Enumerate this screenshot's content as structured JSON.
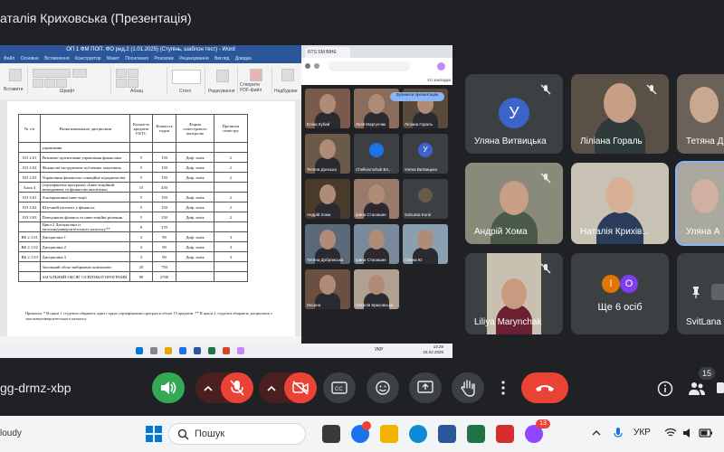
{
  "window": {
    "title": "аталія Криховська (Презентація)"
  },
  "word": {
    "title_bar": "ОП 1 ФМ ПОП. ФО ред.2 (1.01.2025) (Ступінь, шаблон тест) - Word",
    "tabs": [
      "Файл",
      "Основне",
      "Вставлення",
      "Конструктор",
      "Макет",
      "Посилання",
      "Розсилки",
      "Рецензування",
      "Вигляд",
      "Довідка"
    ],
    "ribbon_labels": [
      "Вставити",
      "Шрифт",
      "Абзац",
      "Стилі",
      "Редагування",
      "Створити PDF-файл",
      "Надбудови"
    ],
    "table_headers": [
      "№ з/п",
      "Назва навчальної дисципліни",
      "Кількість кредитів ЄКТС",
      "Кількість годин",
      "Форма семестрового контролю",
      "Протягом семестру"
    ],
    "table_rows": [
      [
        "",
        "управління",
        "",
        "",
        "",
        ""
      ],
      [
        "ЕО 2.01",
        "Ризиково-орієнтоване управління фінансами",
        "5",
        "150",
        "Диф. залік",
        "2"
      ],
      [
        "ЕО 2.02",
        "Фінансові інструменти публічних закупівель",
        "5",
        "150",
        "Диф. залік",
        "2"
      ],
      [
        "ЕО 2.03",
        "Управління фінансово-санаційне підприємства",
        "5",
        "150",
        "Диф. залік",
        "2"
      ],
      [
        "Блок 3",
        "(сертифікатна програма) «Інвестиційний менеджмент та фінансова аналітика»",
        "15",
        "450",
        "",
        ""
      ],
      [
        "ЕО 3.01",
        "Альтернативні інвестиції",
        "5",
        "150",
        "Диф. залік",
        "2"
      ],
      [
        "ЕО 3.02",
        "Штучний інтелект у фінансах",
        "5",
        "150",
        "Диф. залік",
        "2"
      ],
      [
        "ЕО 3.03",
        "Поведінкові фінанси та інвестиційні рішення",
        "5",
        "150",
        "Диф. залік",
        "2"
      ],
      [
        "",
        "Цикл 2 Дисципліни із загальноуніверситетського каталогу**",
        "9",
        "270",
        "",
        ""
      ],
      [
        "ВБ 2.1.01",
        "Дисципліна 1",
        "3",
        "90",
        "Диф. залік",
        "3"
      ],
      [
        "ВБ 2.1.02",
        "Дисципліна 2",
        "3",
        "90",
        "Диф. залік",
        "3"
      ],
      [
        "ВБ 2.1.03",
        "Дисципліна 3",
        "3",
        "90",
        "Диф. залік",
        "3"
      ],
      [
        "",
        "Загальний обсяг вибіркових компонент",
        "25",
        "750",
        "",
        ""
      ],
      [
        "",
        "ЗАГАЛЬНИЙ ОБСЯГ ОСВІТНЬОЇ ПРОГРАМИ",
        "90",
        "2700",
        "",
        ""
      ]
    ],
    "notes": "Примітка: * В циклі 1 студенти обирають один з трьох сертифікатних програм в обсязі 15 кредитів. ** В циклі 2 студенти обирають дисципліни з загальноуніверситетського каталогу."
  },
  "chrome": {
    "tab_title": "RTS SM ВІНЕ рейти...",
    "bookmarks": "Усі закладки",
    "share_pill": "Зупинити презентацію",
    "tiles": [
      {
        "name": "Еліна Кубай",
        "color": "#7a5a4a"
      },
      {
        "name": "Лілія Маргунчак",
        "color": "#8b6b5a"
      },
      {
        "name": "Ліліана Гораль",
        "color": "#5a4a3a"
      },
      {
        "name": "Тетяна Донська",
        "color": "#6b5a4a"
      },
      {
        "name": "Chelkovnichuk Вл...",
        "avatar": "#1a73e8"
      },
      {
        "name": "Уляна Витвицька",
        "avatar": "#3c63c9",
        "initial": "У"
      },
      {
        "name": "Андрій Хома",
        "color": "#4a3a2a"
      },
      {
        "name": "Ірина Стасишин",
        "color": "#9a7a6a"
      },
      {
        "name": "SvitLana Kurul",
        "avatar": "#6a5a4a"
      },
      {
        "name": "Тетяна Добрянська",
        "color": "#5a6a7a"
      },
      {
        "name": "Ірина Стасишин",
        "color": "#7a8a9a"
      },
      {
        "name": "Олена Ю",
        "color": "#8aa0b0"
      },
      {
        "name": "Оксана",
        "color": "#6a5040"
      },
      {
        "name": "Наталія Криховська",
        "color": "#b0a090"
      }
    ],
    "time": "14:29",
    "date": "18.02.2025",
    "lang": "УКР"
  },
  "participants": [
    {
      "name": "Уляна Витвицька",
      "initial": "У"
    },
    {
      "name": "Ліліана Гораль"
    },
    {
      "name": "Тетяна Д"
    },
    {
      "name": "Андрій Хома"
    },
    {
      "name": "Наталія Крихів..."
    },
    {
      "name": "Уляна А"
    },
    {
      "name": "Liliya Marynchak"
    },
    {
      "name": "Ще 6 осіб",
      "initials": [
        "І",
        "О"
      ]
    },
    {
      "name": "SvitLana"
    }
  ],
  "meeting_code": "gg-drmz-xbp",
  "people_count": "15",
  "taskbar": {
    "weather": "loudy",
    "search_placeholder": "Пошук",
    "lang": "УКР",
    "badge_count": "13"
  },
  "colors": {
    "end_call": "#ea4335",
    "mic_off": "#ea4335",
    "active_button": "#34a853",
    "accent": "#8ab4f8"
  }
}
